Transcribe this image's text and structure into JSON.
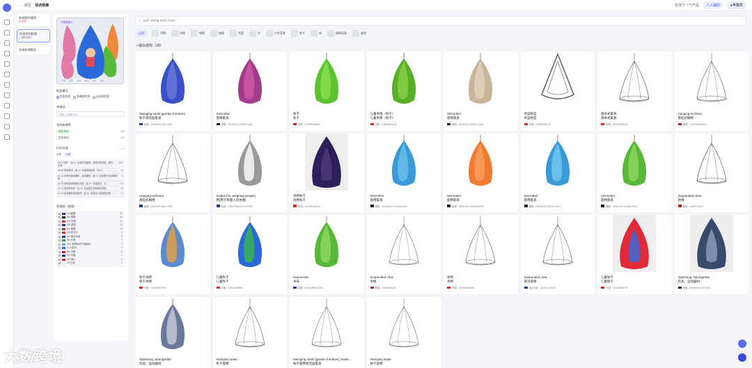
{
  "topbar": {
    "back": "← 返回",
    "title": "综合检索",
    "next": "检测下一个产品",
    "help": "人工辅助",
    "user": "●苹翼草"
  },
  "leftnav": [
    {
      "title": "综合图片搜索",
      "sub": "● 风险",
      "sub_class": "sub"
    },
    {
      "title": "外观专利检索",
      "sub": "• 通知通知",
      "sub_class": "sub2",
      "active": true
    },
    {
      "title": "生成检测报告",
      "sub": "",
      "sub_class": "sub2"
    }
  ],
  "filter": {
    "img_tag": "可替换图片",
    "mode_label": "检索模式",
    "modes": [
      "检索检测",
      "多模图检测",
      "局部图检索"
    ],
    "keyword_label": "关键词",
    "keyword_placeholder": "请输入关键词/ID",
    "patent_label": "专利有效性",
    "patents": [
      {
        "name": "有效专利",
        "n": "190",
        "bg": "#e3f5e7",
        "fg": "#2a9a4a"
      },
      {
        "name": "失效专利",
        "n": "132",
        "bg": "#eef0f5",
        "fg": "#777"
      }
    ],
    "loc_label": "LOC分类",
    "loc_tabs": [
      "大类",
      "小类"
    ],
    "loc_items": [
      {
        "t": "06-01 椅子（含 U）包括所有座椅，带或不带背板，座位、长凳...",
        "n": "1861"
      },
      {
        "t": "06-06 其他家具（含 U）包括其他家具（06-0...",
        "n": "48"
      },
      {
        "t": "21-02 体育用品和器材，运动器材（含 U）包括属于运动器材的...",
        "n": "74"
      },
      {
        "t": "21-03 其他游戏和娱乐用品（含 U）包括射击、打...",
        "n": "48"
      },
      {
        "t": "21-01 游戏和玩具（含 U）包括属于游戏和玩具类...",
        "n": "46"
      },
      {
        "t": "22-03 家具辅件类的套件（含 U）包括可以放置物品的...",
        "n": "12"
      }
    ],
    "country_label": "受理局（国家）",
    "countries": [
      {
        "name": "EU 欧盟",
        "n": "89",
        "c": "#1f3a93"
      },
      {
        "name": "DE 德国",
        "n": "84",
        "c": "#222222"
      },
      {
        "name": "CN 中国",
        "n": "54",
        "c": "#d42a2a"
      },
      {
        "name": "GB 英国",
        "n": "44",
        "c": "#2a3a8a"
      },
      {
        "name": "US 美国",
        "n": "38",
        "c": "#b0262e"
      },
      {
        "name": "CA 加拿大",
        "n": "9",
        "c": "#d42a2a"
      },
      {
        "name": "AU 澳大利亚",
        "n": "8",
        "c": "#1f3a93"
      },
      {
        "name": "BR 巴西",
        "n": "7",
        "c": "#2a9a4a"
      },
      {
        "name": "WO 世界知识产权组织",
        "n": "7",
        "c": "#6aa0d8"
      },
      {
        "name": "IL 以色列",
        "n": "7",
        "c": "#3a6ad8"
      },
      {
        "name": "DK 丹麦",
        "n": "6",
        "c": "#c8102e"
      },
      {
        "name": "FR 法国",
        "n": "6",
        "c": "#2a3a8a"
      },
      {
        "name": "CH 瑞士",
        "n": "5",
        "c": "#d42a2a"
      },
      {
        "name": "JP 日本",
        "n": "3",
        "c": "#eeeeee"
      }
    ]
  },
  "search": {
    "value": "pod swing seat chair"
  },
  "categories": [
    {
      "label": "全部",
      "active": true,
      "img": false
    },
    {
      "label": "吊椅",
      "img": true
    },
    {
      "label": "吊椅",
      "img": true
    },
    {
      "label": "摇椅",
      "img": true
    },
    {
      "label": "摇椅",
      "img": true
    },
    {
      "label": "吊篮",
      "img": true
    },
    {
      "label": "伞",
      "img": true
    },
    {
      "label": "户外家具",
      "img": true
    },
    {
      "label": "秋千",
      "img": true
    },
    {
      "label": "床",
      "img": true
    },
    {
      "label": "摇椅家具",
      "img": true
    },
    {
      "label": "其他",
      "img": true
    }
  ],
  "section_title": "• 疑似侵权（28）",
  "products": [
    {
      "title": "Swinging seats [garden furniture]",
      "sub": "秋千或花园家具",
      "meta": "欧盟 · EU006412031-0005",
      "flag": "#1f3a93",
      "kind": "pod",
      "c1": "#3a4fc8",
      "c2": "#6a7ad8"
    },
    {
      "title": "Sitzmöbel",
      "sub": "座椅家具",
      "meta": "德国 · DE402017202320-0001",
      "flag": "#222222",
      "kind": "pod",
      "c1": "#a23c8c",
      "c2": "#d05aa8"
    },
    {
      "title": "秋千",
      "sub": "秋千",
      "meta": "中国 · CN305446813",
      "flag": "#d42a2a",
      "kind": "pod",
      "c1": "#5cc230",
      "c2": "#8ae050"
    },
    {
      "title": "儿童吊椅（秋千）",
      "sub": "儿童吊椅（秋千）",
      "meta": "中国 · CN306673418",
      "flag": "#d42a2a",
      "kind": "pod",
      "c1": "#58b028",
      "c2": "#8ad04a"
    },
    {
      "title": "Sitzmöbel",
      "sub": "座椅家具",
      "meta": "德国 · DE402017202321-0001",
      "flag": "#222222",
      "kind": "pod",
      "c1": "#c9b49a",
      "c2": "#e2d3c0"
    },
    {
      "title": "吊篮秋篮",
      "sub": "吊篮秋篮",
      "meta": "中国 · CN305404175",
      "flag": "#d42a2a",
      "kind": "tri",
      "c1": "#555",
      "c2": "#fff"
    },
    {
      "title": "悬吊式家具",
      "sub": "悬吊式家具",
      "meta": "中国 · CN304383069",
      "flag": "#d42a2a",
      "kind": "tent",
      "c1": "#555",
      "c2": "#fff"
    },
    {
      "title": "Hanging recliners",
      "sub": "悬挂式躺椅",
      "meta": "美国 · USD0925625S0",
      "flag": "#b0262e",
      "kind": "tent",
      "c1": "#666",
      "c2": "#fff"
    },
    {
      "title": "Hanging recliners",
      "sub": "悬挂式躺椅",
      "meta": "欧盟 · EU0079236S1-0005",
      "flag": "#1f3a93",
      "kind": "tent",
      "c1": "#555",
      "c2": "#fff"
    },
    {
      "title": "Scales [for weighing people]",
      "sub": "秤[用于称量人的体重]",
      "meta": "英国 · GB9003681017000030",
      "flag": "#2a3a8a",
      "kind": "pod",
      "c1": "#999",
      "c2": "#fff"
    },
    {
      "title": "吊椅秋千",
      "sub": "吊椅秋千",
      "meta": "中国 · CN305446720",
      "flag": "#d42a2a",
      "kind": "podsolid",
      "c1": "#2e1f5a",
      "c2": "#4b3a7a"
    },
    {
      "title": "Sitzmöbel",
      "sub": "座椅家具",
      "meta": "德国 · DE402017202326-0001",
      "flag": "#222222",
      "kind": "pod",
      "c1": "#3a9ad8",
      "c2": "#6ac0ea"
    },
    {
      "title": "Sitzmöbel",
      "sub": "座椅家具",
      "meta": "德国 · DE402017202328-0001",
      "flag": "#222222",
      "kind": "pod",
      "c1": "#f07a30",
      "c2": "#f8a060"
    },
    {
      "title": "Sitzmöbel",
      "sub": "座椅家具",
      "meta": "德国 · DE402017202327-0001",
      "flag": "#222222",
      "kind": "pod",
      "c1": "#3a9ad8",
      "c2": "#78c8f0"
    },
    {
      "title": "Sitzmöbel",
      "sub": "座椅家具",
      "meta": "德国 · DE402017202330-0001",
      "flag": "#222222",
      "kind": "pod",
      "c1": "#58b838",
      "c2": "#90d860"
    },
    {
      "title": "Suspended chair",
      "sub": "吊椅",
      "meta": "美国 · USD0711067",
      "flag": "#b0262e",
      "kind": "tent",
      "c1": "#555",
      "c2": "#fff"
    },
    {
      "title": "秋千吊椅",
      "sub": "秋千吊椅",
      "meta": "中国 · CN305397930",
      "flag": "#d42a2a",
      "kind": "pod",
      "c1": "#5a8ad0",
      "c2": "#e8a040"
    },
    {
      "title": "儿童秋千",
      "sub": "儿童秋千",
      "meta": "中国 · CN302865532",
      "flag": "#d42a2a",
      "kind": "pod",
      "c1": "#2a6ad8",
      "c2": "#3ab848"
    },
    {
      "title": "Hammocks",
      "sub": "吊床",
      "meta": "欧盟 · EU0028816-0010",
      "flag": "#1f3a93",
      "kind": "pod",
      "c1": "#58b838",
      "c2": "#90d860"
    },
    {
      "title": "Suspended chair",
      "sub": "吊椅",
      "meta": "美国 · USD4455221",
      "flag": "#b0262e",
      "kind": "tent",
      "c1": "#777",
      "c2": "#fff"
    },
    {
      "title": "吊椅",
      "sub": "吊椅",
      "meta": "中国 · CN305446855",
      "flag": "#d42a2a",
      "kind": "tent",
      "c1": "#666",
      "c2": "#fff"
    },
    {
      "title": "Suspended seat",
      "sub": "悬浮座椅",
      "meta": "澳大利亚 · AU201716424",
      "flag": "#1f3a93",
      "kind": "tent",
      "c1": "#666",
      "c2": "#fff"
    },
    {
      "title": "儿童秋千",
      "sub": "儿童秋千",
      "meta": "中国 · CN305298720",
      "flag": "#d42a2a",
      "kind": "podsolid",
      "c1": "#e02a3a",
      "c2": "#3a6ad8"
    },
    {
      "title": "Spielzeug; Sportgeräte",
      "sub": "玩具、运动器材",
      "meta": "德国 · DE402014026-0001",
      "flag": "#222222",
      "kind": "podsolid",
      "c1": "#3a4a6a",
      "c2": "#8a9ab8"
    },
    {
      "title": "Spielzeug; Sportgeräte",
      "sub": "玩具、运动器材",
      "meta": "德国 · DE402014026-0002",
      "flag": "#222222",
      "kind": "pod",
      "c1": "#6a7a9a",
      "c2": "#c8ccd8"
    },
    {
      "title": "Swinging seats",
      "sub": "秋千座椅",
      "meta": "欧盟 · EU003210034-0001",
      "flag": "#1f3a93",
      "kind": "tent",
      "c1": "#666",
      "c2": "#fff"
    },
    {
      "title": "Swinging seats [garden furniture]; Seats ...",
      "sub": "秋千座椅或花园家具",
      "meta": "欧盟 · EU003210034-0002",
      "flag": "#1f3a93",
      "kind": "tent",
      "c1": "#777",
      "c2": "#fff"
    },
    {
      "title": "Swinging seats",
      "sub": "秋千座椅",
      "meta": "欧盟 · EU003210034-0003",
      "flag": "#1f3a93",
      "kind": "tent",
      "c1": "#777",
      "c2": "#fff"
    }
  ],
  "watermark": "大数跨境"
}
